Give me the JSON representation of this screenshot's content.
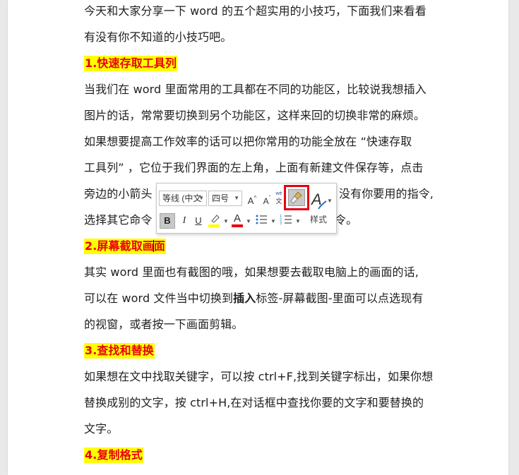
{
  "document": {
    "intro_lines": [
      "今天和大家分享一下 word 的五个超实用的小技巧，下面我们来看看",
      "有没有你不知道的小技巧吧。"
    ],
    "section1": {
      "heading": "1.快速存取工具列",
      "lines": [
        "当我们在 word 里面常用的工具都在不同的功能区，比较说我想插入",
        "图片的话，常常要切换到另个功能区，这样来回的切换非常的麻烦。",
        "如果想要提高工作效率的话可以把你常用的功能全放在 “快速存取",
        "工具列” ，它位于我们界面的左上角，上面有新建文件保存等，点击"
      ],
      "line5_left": "旁边的小箭头",
      "line5_right": "没有你要用的指令,",
      "line6_left": "选择其它命令",
      "line6_right": "令。"
    },
    "section2": {
      "heading_a": "2.屏幕截取画",
      "heading_b": "面",
      "line1": "其实  word  里面也有截图的哦，如果想要去截取电脑上的画面的话,",
      "line2_a": "可以在 word 文件当中切换到",
      "line2_bold": "插入",
      "line2_b": "标签-屏幕截图-里面可以点选现有",
      "line3": "的视窗，或者按一下画面剪辑。"
    },
    "section3": {
      "heading": "3.查找和替换",
      "lines": [
        "如果想在文中找取关键字，可以按 ctrl+F,找到关键字标出，如果你想",
        "替换成别的文字，按  ctrl+H,在对话框中查找你要的文字和要替换的",
        "文字。"
      ]
    },
    "section4": {
      "heading": "4.复制格式"
    }
  },
  "mini_toolbar": {
    "font_name": "等线 (中文",
    "font_size": "四号",
    "grow_font": "A",
    "shrink_font": "A",
    "bold": "B",
    "italic": "I",
    "underline": "U",
    "font_color_letter": "A",
    "styles_label": "样式",
    "styles_letter": "A",
    "colors": {
      "highlight": "#ffff00",
      "font_color": "#e8000b",
      "callout": "#e60012"
    }
  }
}
